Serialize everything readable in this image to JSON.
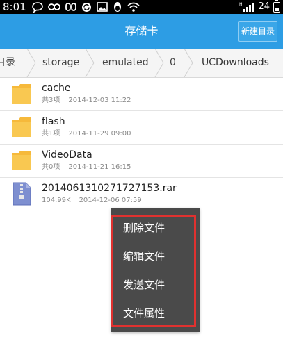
{
  "status_bar": {
    "time": "8:01",
    "battery_level": "24",
    "left_icons": [
      "chat-bubble-icon",
      "infinity-icon",
      "link-icon",
      "sync-icon",
      "image-icon",
      "penguin-icon",
      "wifi-icon"
    ],
    "right_icons": [
      "hspa-signal-icon",
      "battery-icon"
    ]
  },
  "titlebar": {
    "title": "存储卡",
    "new_dir_label": "新建目录",
    "bg_color": "#2d9de4"
  },
  "breadcrumb": {
    "items": [
      "目录",
      "storage",
      "emulated",
      "0",
      "UCDownloads"
    ]
  },
  "files": [
    {
      "name": "cache",
      "count": "共3项",
      "date": "2014-12-03 11:22",
      "type": "folder-icon"
    },
    {
      "name": "flash",
      "count": "共1项",
      "date": "2014-11-29 09:00",
      "type": "folder-icon"
    },
    {
      "name": "VideoData",
      "count": "共0项",
      "date": "2014-11-21 16:15",
      "type": "folder-icon"
    },
    {
      "name": "2014061310271727153.rar",
      "count": "104.99K",
      "date": "2014-12-06 07:59",
      "type": "archive-icon"
    }
  ],
  "context_menu": {
    "items": [
      "删除文件",
      "编辑文件",
      "发送文件",
      "文件属性"
    ],
    "highlight_color": "#e0312f"
  }
}
